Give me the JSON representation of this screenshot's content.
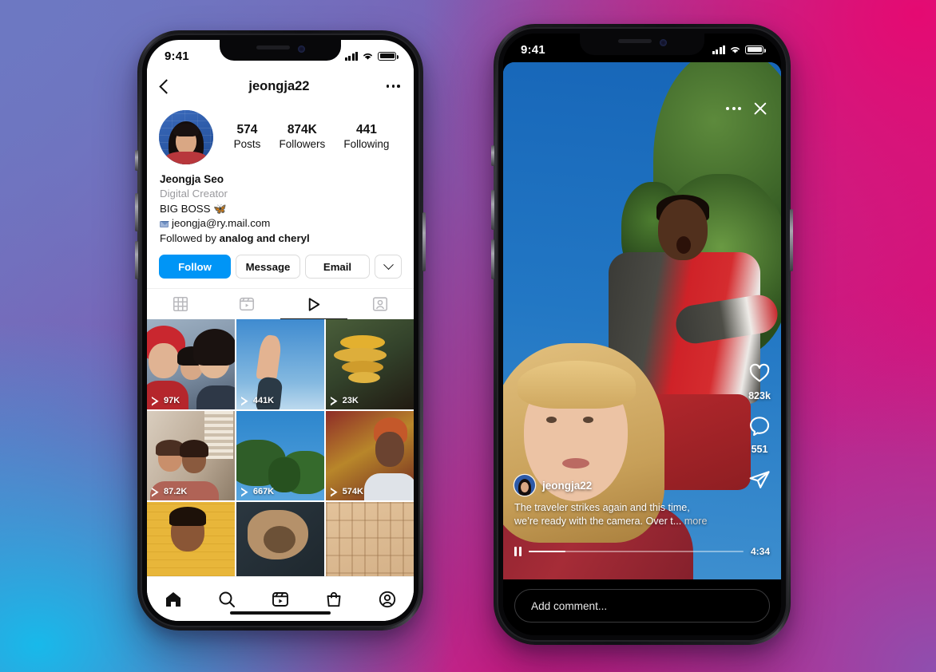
{
  "background": {
    "gradient_colors": [
      "#6d78c2",
      "#e50a72",
      "#18b9ea",
      "#8e4faf"
    ]
  },
  "accent": {
    "instagram_blue": "#0095F6"
  },
  "left_phone": {
    "status_bar": {
      "time": "9:41",
      "signal": "signal-bars",
      "wifi": "wifi-icon",
      "battery": "battery-icon"
    },
    "header": {
      "back": "back-chevron-icon",
      "title": "jeongja22",
      "more": "more-options-icon"
    },
    "profile": {
      "avatar": "profile-avatar",
      "stats": [
        {
          "number": "574",
          "label": "Posts"
        },
        {
          "number": "874K",
          "label": "Followers"
        },
        {
          "number": "441",
          "label": "Following"
        }
      ],
      "full_name": "Jeongja Seo",
      "category": "Digital Creator",
      "bio_line": "BIG BOSS 🦋",
      "email": "jeongja@ry.mail.com",
      "followed_by_prefix": "Followed by ",
      "followed_by_names": "analog and cheryl"
    },
    "actions": {
      "follow": "Follow",
      "message": "Message",
      "email": "Email",
      "more": "chevron-down-icon"
    },
    "tabs": [
      {
        "name": "grid",
        "icon": "grid-icon",
        "active": false
      },
      {
        "name": "reels",
        "icon": "reels-icon",
        "active": false
      },
      {
        "name": "video",
        "icon": "play-icon",
        "active": true
      },
      {
        "name": "tagged",
        "icon": "tagged-icon",
        "active": false
      }
    ],
    "grid": [
      {
        "views": "97K",
        "desc": "three-friends-selfie"
      },
      {
        "views": "441K",
        "desc": "hand-against-sky"
      },
      {
        "views": "23K",
        "desc": "yellow-mushrooms"
      },
      {
        "views": "87.2K",
        "desc": "couple-indoors"
      },
      {
        "views": "667K",
        "desc": "trees-blue-sky"
      },
      {
        "views": "574K",
        "desc": "portrait-gold-backdrop"
      },
      {
        "views": "",
        "desc": "person-yellow-wall"
      },
      {
        "views": "",
        "desc": "craft-on-dark-ground"
      },
      {
        "views": "",
        "desc": "carved-tan-wall"
      }
    ],
    "tabbar": [
      {
        "name": "home",
        "icon": "home-icon",
        "active": true
      },
      {
        "name": "search",
        "icon": "search-icon",
        "active": false
      },
      {
        "name": "reels",
        "icon": "reels-icon",
        "active": false
      },
      {
        "name": "shop",
        "icon": "shop-bag-icon",
        "active": false
      },
      {
        "name": "profile",
        "icon": "profile-icon",
        "active": false
      }
    ]
  },
  "right_phone": {
    "status_bar": {
      "time": "9:41",
      "signal": "signal-bars",
      "wifi": "wifi-icon",
      "battery": "battery-icon"
    },
    "top_actions": {
      "more": "more-options-icon",
      "close": "close-icon"
    },
    "side_actions": {
      "like_icon": "heart-icon",
      "like_count": "823k",
      "comment_icon": "comment-icon",
      "comment_count": "551",
      "share_icon": "share-paper-plane-icon"
    },
    "meta": {
      "avatar": "author-avatar",
      "username": "jeongja22",
      "caption_line1": "The traveler strikes again and this time,",
      "caption_line2": "we’re ready with the camera. Over t...",
      "more_label": "more"
    },
    "player": {
      "pause_icon": "pause-icon",
      "progress_percent": 17,
      "duration": "4:34"
    },
    "comment_input": {
      "placeholder": "Add comment..."
    }
  }
}
